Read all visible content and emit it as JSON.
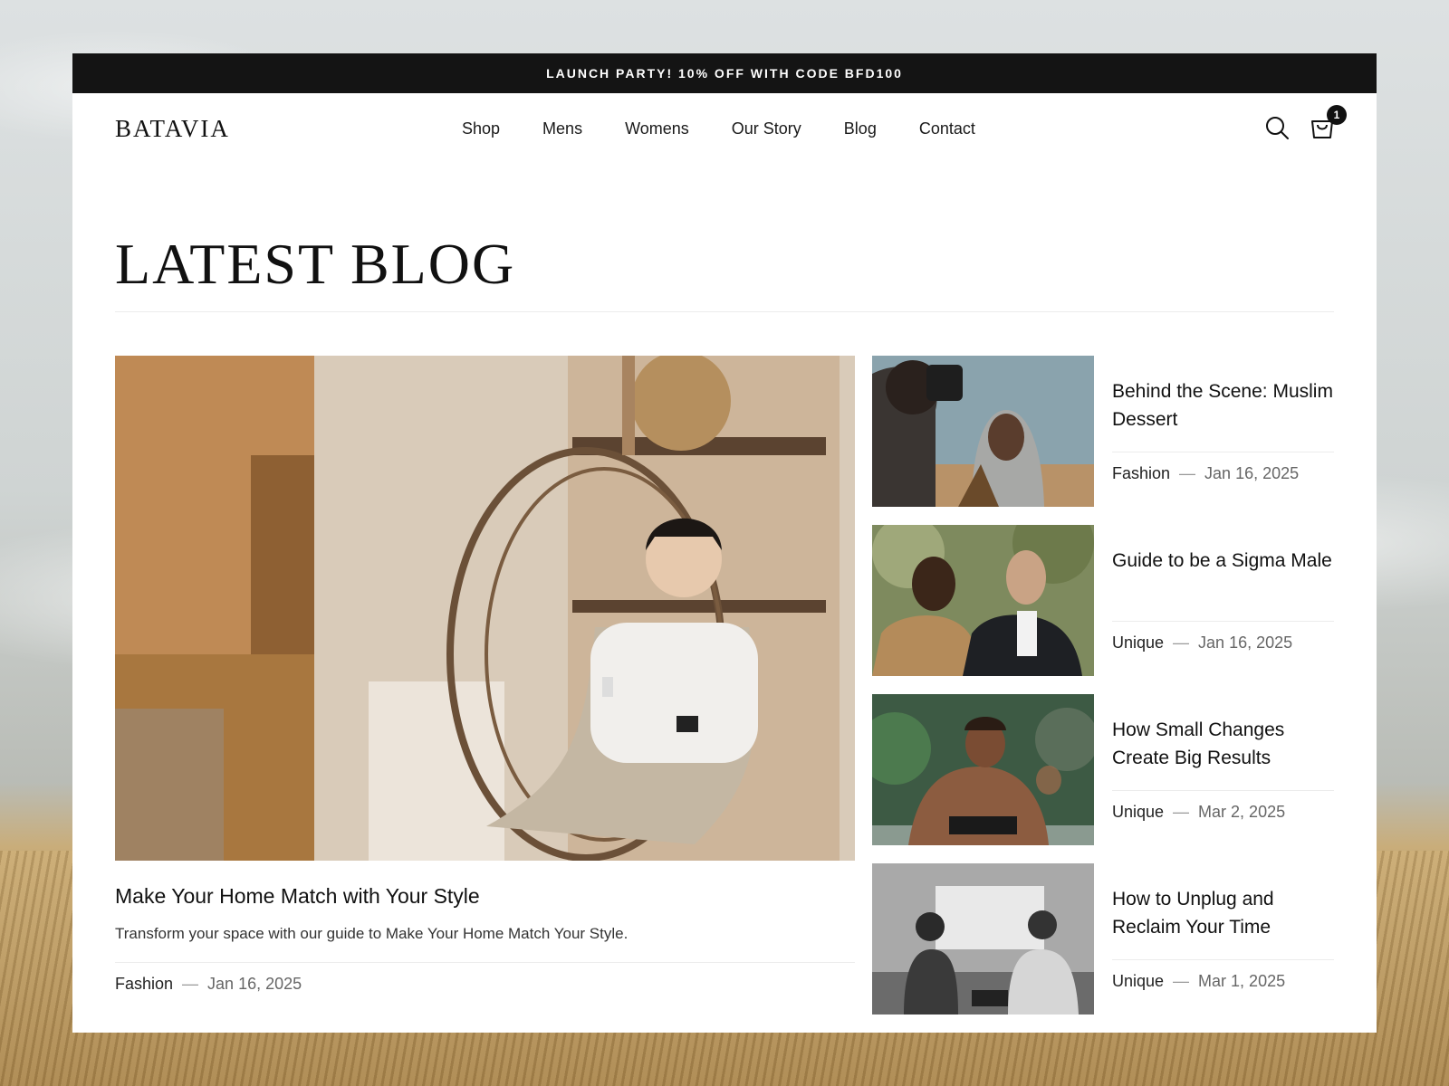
{
  "announcement": "LAUNCH PARTY! 10% OFF WITH CODE BFD100",
  "brand": "BATAVIA",
  "nav": [
    "Shop",
    "Mens",
    "Womens",
    "Our Story",
    "Blog",
    "Contact"
  ],
  "cart_count": "1",
  "page_title": "LATEST BLOG",
  "featured": {
    "title": "Make Your Home Match with Your Style",
    "excerpt": "Transform your space with our guide to Make Your Home Match Your Style.",
    "category": "Fashion",
    "date": "Jan 16, 2025"
  },
  "posts": [
    {
      "title": "Behind the Scene: Muslim Dessert",
      "category": "Fashion",
      "date": "Jan 16, 2025"
    },
    {
      "title": "Guide to be a Sigma Male",
      "category": "Unique",
      "date": "Jan 16, 2025"
    },
    {
      "title": "How Small Changes Create Big Results",
      "category": "Unique",
      "date": "Mar 2, 2025"
    },
    {
      "title": "How to Unplug and Reclaim Your Time",
      "category": "Unique",
      "date": "Mar 1, 2025"
    }
  ],
  "meta_separator": "—",
  "icons": {
    "search": "search-icon",
    "cart": "shopping-bag-icon"
  },
  "colors": {
    "announcement_bg": "#141414",
    "text": "#111111",
    "divider": "#ececec"
  }
}
